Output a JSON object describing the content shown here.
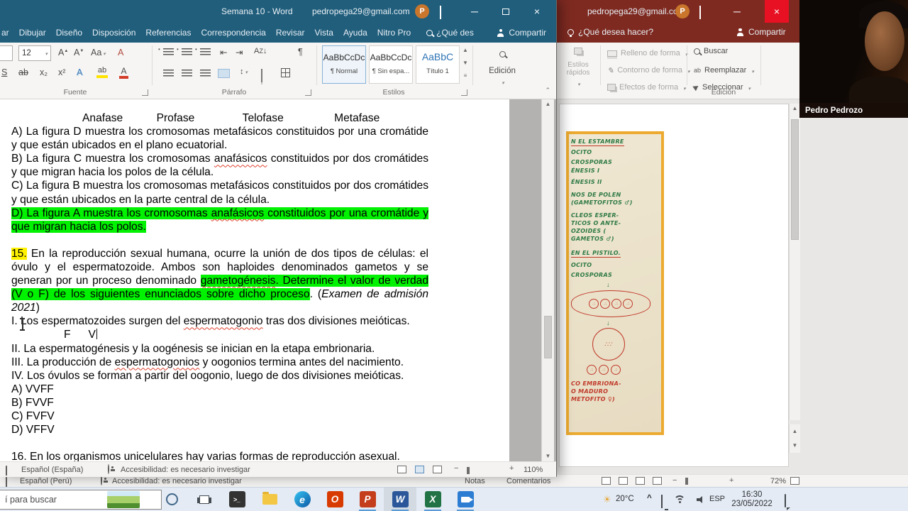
{
  "word": {
    "title": "Semana 10 - Word",
    "account": {
      "email": "pedropega29@gmail.com",
      "initial": "P"
    },
    "tabs": {
      "partial": "ar",
      "t1": "Dibujar",
      "t2": "Diseño",
      "t3": "Disposición",
      "t4": "Referencias",
      "t5": "Correspondencia",
      "t6": "Revisar",
      "t7": "Vista",
      "t8": "Ayuda",
      "t9": "Nitro Pro"
    },
    "tellme": "¿Qué des",
    "share": "Compartir",
    "ribbon": {
      "font_size": "12",
      "groups": {
        "font": "Fuente",
        "paragraph": "Párrafo",
        "styles": "Estilos"
      },
      "styles": {
        "s1p": "AaBbCcDc",
        "s1n": "¶ Normal",
        "s2p": "AaBbCcDc",
        "s2n": "¶ Sin espa...",
        "s3p": "AaBbC",
        "s3n": "Título 1"
      },
      "editing": "Edición"
    },
    "doc": {
      "phases": {
        "p1": "Anafase",
        "p2": "Profase",
        "p3": "Telofase",
        "p4": "Metafase"
      },
      "pa": "A) La figura D muestra los cromosomas metafásicos constituidos por una cromátide y que están ubicados en el plano ecuatorial.",
      "pb_pre": "B) La figura C muestra los cromosomas ",
      "pb_sq": "anafásicos",
      "pb_post": " constituidos por dos cromátides y que migran hacia los polos de la célula.",
      "pc": "C) La figura B muestra los cromosomas metafásicos constituidos por dos cromátides y que están ubicados en la parte central de la célula.",
      "pd_pre": "D) La figura A muestra los cromosomas ",
      "pd_sq": "anafásicos",
      "pd_post": " constituidos por una cromátide y que migran hacia los polos.",
      "q15_num": "15.",
      "q15_a": " En la reproducción sexual humana, ocurre la unión de dos tipos de células: el óvulo y el espermatozoide. Ambos son haploides denominados gametos y se generan por un proceso denominado ",
      "q15_hl_sq": "gametogénesis",
      "q15_hl": ". Determine el valor de verdad (V o F) de los siguientes enunciados sobre dicho proceso",
      "q15_b": ". (",
      "q15_cite": "Examen de admisión 2021",
      "q15_c": ")",
      "r1_pre": "I. Los espermatozoides surgen del ",
      "r1_sq": "espermatogonio",
      "r1_post": " tras dos divisiones meióticas.",
      "ans_f": "F",
      "ans_v": "V",
      "r2": "II. La espermatogénesis y la oogénesis se inician en la etapa embrionaria.",
      "r3_pre": "III. La producción de ",
      "r3_sq": "espermatogonios",
      "r3_post": " y oogonios termina antes del nacimiento.",
      "r4": "IV. Los óvulos se forman a partir del oogonio, luego de dos divisiones meióticas.",
      "oa": "A) VVFF",
      "ob": "B) FVVF",
      "oc": "C) FVFV",
      "od": "D) VFFV",
      "q16": "16. En los organismos unicelulares hay varias formas de reproducción asexual."
    },
    "status": {
      "lang": "Español (España)",
      "access": "Accesibilidad: es necesario investigar",
      "zoom": "110%"
    }
  },
  "ppt": {
    "account": {
      "email": "pedropega29@gmail.com",
      "initial": "P"
    },
    "tellme": "¿Qué desea hacer?",
    "share": "Compartir",
    "ribbon": {
      "quick_styles": "Estilos rápidos",
      "fill": "Relleno de forma",
      "outline": "Contorno de forma",
      "effects": "Efectos de forma",
      "find": "Buscar",
      "replace": "Reemplazar",
      "select": "Seleccionar",
      "editing": "Edición"
    },
    "notes": {
      "n1": "N EL ESTAMBRE",
      "n2": "OCITO",
      "n3": "CROSPORAS",
      "n4": "ÉNESIS I",
      "n5": "ÉNESIS II",
      "n6": "NOS DE POLEN",
      "n7": "(GAMETOFITOS ♂)",
      "n8": "CLEOS ESPER-",
      "n9": "TICOS O ANTE-",
      "n10": "OZOIDES (",
      "n11": "GAMETOS ♂)",
      "n12": "EN EL PISTILO.",
      "n13": "OCITO",
      "n14": "CROSPORAS",
      "n15": "CO EMBRIONA-",
      "n16": "O MADURO",
      "n17": "METOFITO ♀)"
    },
    "status": {
      "lang": "Español (Perú)",
      "access": "Accesibilidad: es necesario investigar",
      "notes": "Notas",
      "comments": "Comentarios",
      "zoom": "72%"
    }
  },
  "webcam": {
    "name": "Pedro Pedrozo"
  },
  "taskbar": {
    "search_hint": "í para buscar",
    "weather": "20°C",
    "lang": "ESP",
    "time": "16:30",
    "date": "23/05/2022"
  }
}
